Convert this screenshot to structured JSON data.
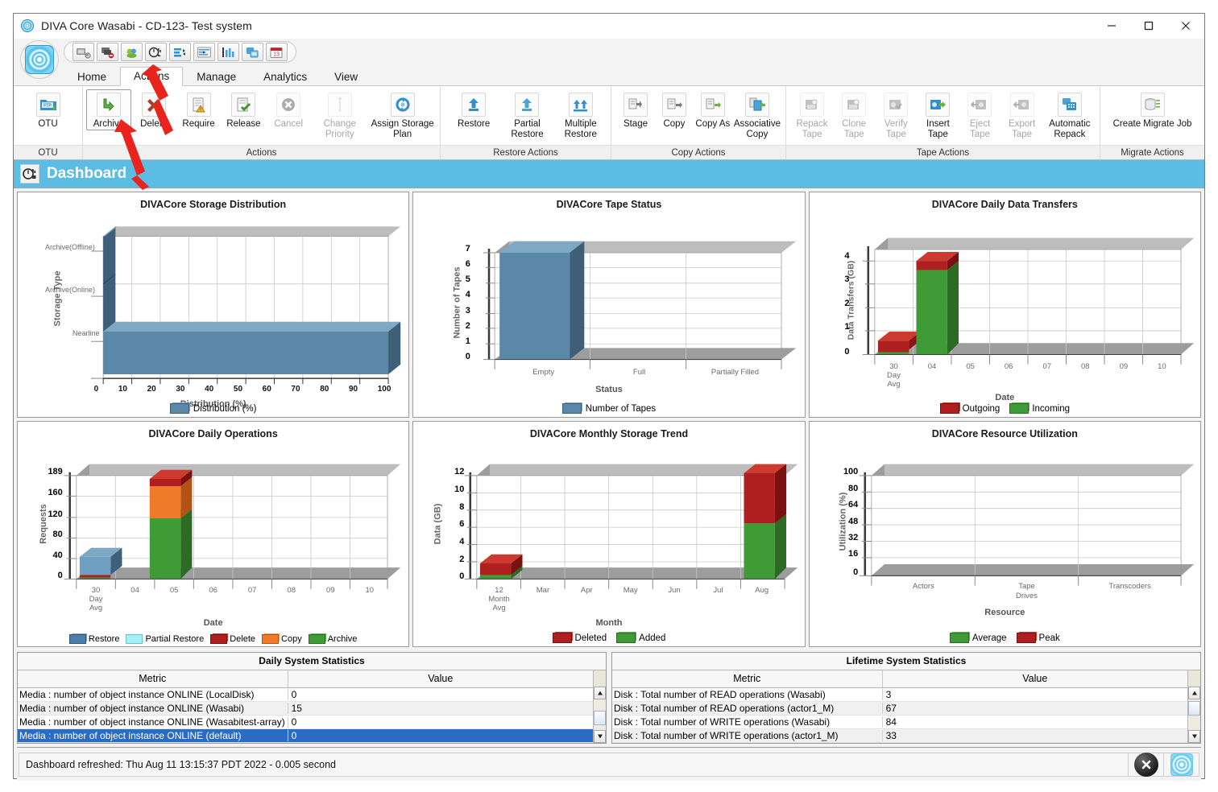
{
  "window": {
    "title": "DIVA Core  Wasabi - CD-123- Test system",
    "minimize_label": "–",
    "maximize_label": "□",
    "close_label": "✕"
  },
  "quick_access": [
    {
      "name": "transfer-icon",
      "tip": "Transfer"
    },
    {
      "name": "cancel-transfer-icon",
      "tip": "Cancel Transfer"
    },
    {
      "name": "archive-objects-icon",
      "tip": "Archive Objects"
    },
    {
      "name": "dashboard-icon",
      "tip": "Dashboard"
    },
    {
      "name": "requests-icon",
      "tip": "Requests"
    },
    {
      "name": "jobs-icon",
      "tip": "Jobs"
    },
    {
      "name": "analytics-icon",
      "tip": "Analytics"
    },
    {
      "name": "copies-icon",
      "tip": "Copies"
    },
    {
      "name": "schedule-icon",
      "tip": "Schedule"
    }
  ],
  "tabs": [
    {
      "label": "Home",
      "active": false
    },
    {
      "label": "Actions",
      "active": true
    },
    {
      "label": "Manage",
      "active": false
    },
    {
      "label": "Analytics",
      "active": false
    },
    {
      "label": "View",
      "active": false
    }
  ],
  "ribbon_groups": [
    {
      "label": "OTU",
      "items": [
        {
          "label": "OTU",
          "icon": "otu-folder-icon",
          "disabled": false,
          "selected": false,
          "width": "normal"
        }
      ]
    },
    {
      "label": "Actions",
      "items": [
        {
          "label": "Archive",
          "icon": "archive-arrow-icon",
          "disabled": false,
          "selected": true,
          "width": "normal"
        },
        {
          "label": "Delete",
          "icon": "delete-x-icon",
          "disabled": false,
          "selected": false,
          "width": "normal"
        },
        {
          "label": "Require",
          "icon": "require-doc-icon",
          "disabled": false,
          "selected": false,
          "width": "normal"
        },
        {
          "label": "Release",
          "icon": "release-doc-icon",
          "disabled": false,
          "selected": false,
          "width": "normal"
        },
        {
          "label": "Cancel",
          "icon": "cancel-circle-icon",
          "disabled": true,
          "selected": false,
          "width": "normal"
        },
        {
          "label": "Change Priority",
          "icon": "change-priority-icon",
          "disabled": true,
          "selected": false,
          "width": "wide"
        },
        {
          "label": "Assign Storage Plan",
          "icon": "assign-storage-plan-icon",
          "disabled": false,
          "selected": false,
          "width": "xwide"
        }
      ]
    },
    {
      "label": "Restore Actions",
      "items": [
        {
          "label": "Restore",
          "icon": "restore-up-arrow-icon",
          "disabled": false,
          "selected": false,
          "width": "normal"
        },
        {
          "label": "Partial Restore",
          "icon": "partial-restore-icon",
          "disabled": false,
          "selected": false,
          "width": "wide"
        },
        {
          "label": "Multiple Restore",
          "icon": "multiple-restore-icon",
          "disabled": false,
          "selected": false,
          "width": "wide"
        }
      ]
    },
    {
      "label": "Copy Actions",
      "items": [
        {
          "label": "Stage",
          "icon": "stage-icon",
          "disabled": false,
          "selected": false,
          "width": "normal"
        },
        {
          "label": "Copy",
          "icon": "copy-icon",
          "disabled": false,
          "selected": false,
          "width": "normal"
        },
        {
          "label": "Copy As",
          "icon": "copy-as-icon",
          "disabled": false,
          "selected": false,
          "width": "normal"
        },
        {
          "label": "Associative Copy",
          "icon": "associative-copy-icon",
          "disabled": false,
          "selected": false,
          "width": "wide"
        }
      ]
    },
    {
      "label": "Tape Actions",
      "items": [
        {
          "label": "Repack Tape",
          "icon": "repack-tape-icon",
          "disabled": true,
          "selected": false,
          "width": "normal"
        },
        {
          "label": "Clone Tape",
          "icon": "clone-tape-icon",
          "disabled": true,
          "selected": false,
          "width": "normal"
        },
        {
          "label": "Verify Tape",
          "icon": "verify-tape-icon",
          "disabled": true,
          "selected": false,
          "width": "normal"
        },
        {
          "label": "Insert Tape",
          "icon": "insert-tape-icon",
          "disabled": false,
          "selected": false,
          "width": "normal"
        },
        {
          "label": "Eject Tape",
          "icon": "eject-tape-icon",
          "disabled": true,
          "selected": false,
          "width": "normal"
        },
        {
          "label": "Export Tape",
          "icon": "export-tape-icon",
          "disabled": true,
          "selected": false,
          "width": "normal"
        },
        {
          "label": "Automatic Repack",
          "icon": "automatic-repack-icon",
          "disabled": false,
          "selected": false,
          "width": "wide"
        }
      ]
    },
    {
      "label": "Migrate Actions",
      "items": [
        {
          "label": "Create Migrate Job",
          "icon": "create-migrate-job-icon",
          "disabled": false,
          "selected": false,
          "width": "xwide"
        }
      ]
    }
  ],
  "page_header": {
    "title": "Dashboard",
    "icon": "dashboard-icon",
    "background": "#5bbce4"
  },
  "colors": {
    "bar_blue": "#5b87a8",
    "bar_blue_top": "#7fa8c4",
    "bar_blue_side": "#3e5f78",
    "green": "#3f9b35",
    "green_top": "#5ab94f",
    "dark_red": "#b01f1f",
    "dark_red_top": "#cf3a30",
    "orange": "#ef7b2a",
    "orange_top": "#f79a53",
    "cyan": "#a8f0f7",
    "floor_gray": "#9d9d9d",
    "wall_gray": "#bdbdbd",
    "selection_blue": "#2a6bc4"
  },
  "chart_data": [
    {
      "type": "bar",
      "orientation": "horizontal",
      "panel": "storage-distribution",
      "title": "DIVACore Storage Distribution",
      "xlabel": "Distribution (%)",
      "ylabel": "Storage Type",
      "categories": [
        "Archive(Offline)",
        "Archive(Online)",
        "Nearline"
      ],
      "values": [
        0,
        0,
        100
      ],
      "xticks": [
        0,
        10,
        20,
        30,
        40,
        50,
        60,
        70,
        80,
        90,
        100
      ],
      "xlim": [
        0,
        100
      ],
      "legend": [
        {
          "label": "Distribution (%)",
          "color": "#5b87a8"
        }
      ],
      "legend_position": "bottom",
      "grid": true
    },
    {
      "type": "bar",
      "orientation": "vertical",
      "panel": "tape-status",
      "title": "DIVACore Tape Status",
      "xlabel": "Status",
      "ylabel": "Number of Tapes",
      "categories": [
        "Empty",
        "Full",
        "Partially Filled"
      ],
      "values": [
        7,
        0,
        0
      ],
      "yticks": [
        0,
        1,
        2,
        3,
        4,
        5,
        6,
        7
      ],
      "ylim": [
        0,
        7
      ],
      "legend": [
        {
          "label": "Number of Tapes",
          "color": "#5b87a8"
        }
      ],
      "legend_position": "bottom",
      "grid": true
    },
    {
      "type": "bar",
      "orientation": "vertical",
      "stacked": true,
      "panel": "daily-data-transfers",
      "title": "DIVACore Daily Data Transfers",
      "xlabel": "Date",
      "ylabel": "Data Transfers (GB)",
      "categories": [
        "30 Day Avg",
        "04",
        "05",
        "06",
        "07",
        "08",
        "09",
        "10"
      ],
      "series": [
        {
          "name": "Incoming",
          "color": "#3f9b35",
          "values": [
            0.1,
            3.7,
            0,
            0,
            0,
            0,
            0,
            0
          ]
        },
        {
          "name": "Outgoing",
          "color": "#b01f1f",
          "values": [
            0.5,
            0.4,
            0,
            0,
            0,
            0,
            0,
            0
          ]
        }
      ],
      "yticks": [
        0,
        1,
        2,
        3,
        4
      ],
      "ylim": [
        0,
        4.5
      ],
      "legend": [
        {
          "label": "Outgoing",
          "color": "#b01f1f"
        },
        {
          "label": "Incoming",
          "color": "#3f9b35"
        }
      ],
      "legend_position": "bottom",
      "grid": true
    },
    {
      "type": "bar",
      "orientation": "vertical",
      "stacked": true,
      "panel": "daily-operations",
      "title": "DIVACore Daily Operations",
      "xlabel": "Date",
      "ylabel": "Requests",
      "categories": [
        "30 Day Avg",
        "04",
        "05",
        "06",
        "07",
        "08",
        "09",
        "10"
      ],
      "series": [
        {
          "name": "Restore",
          "color": "#4a7fa8",
          "values": [
            33,
            0,
            0,
            0,
            0,
            0,
            0,
            0
          ]
        },
        {
          "name": "Partial Restore",
          "color": "#a8f0f7",
          "values": [
            0,
            0,
            0,
            0,
            0,
            0,
            0,
            0
          ]
        },
        {
          "name": "Delete",
          "color": "#b01f1f",
          "values": [
            4,
            14,
            0,
            0,
            0,
            0,
            0,
            0
          ]
        },
        {
          "name": "Copy",
          "color": "#ef7b2a",
          "values": [
            0,
            60,
            0,
            0,
            0,
            0,
            0,
            0
          ]
        },
        {
          "name": "Archive",
          "color": "#3f9b35",
          "values": [
            2,
            115,
            0,
            0,
            0,
            0,
            0,
            0
          ]
        }
      ],
      "yticks": [
        0,
        40,
        80,
        120,
        160,
        189
      ],
      "ylim": [
        0,
        189
      ],
      "legend": [
        {
          "label": "Restore",
          "color": "#4a7fa8"
        },
        {
          "label": "Partial Restore",
          "color": "#a8f0f7"
        },
        {
          "label": "Delete",
          "color": "#b01f1f"
        },
        {
          "label": "Copy",
          "color": "#ef7b2a"
        },
        {
          "label": "Archive",
          "color": "#3f9b35"
        }
      ],
      "legend_position": "bottom",
      "grid": true
    },
    {
      "type": "bar",
      "orientation": "vertical",
      "stacked": true,
      "panel": "monthly-storage-trend",
      "title": "DIVACore Monthly Storage Trend",
      "xlabel": "Month",
      "ylabel": "Data (GB)",
      "categories": [
        "12 Month Avg",
        "Mar",
        "Apr",
        "May",
        "Jun",
        "Jul",
        "Aug"
      ],
      "series": [
        {
          "name": "Added",
          "color": "#3f9b35",
          "values": [
            0.5,
            0,
            0,
            0,
            0,
            0,
            6.5
          ]
        },
        {
          "name": "Deleted",
          "color": "#b01f1f",
          "values": [
            1.4,
            0,
            0,
            0,
            0,
            0,
            5.8
          ]
        }
      ],
      "yticks": [
        0,
        2,
        4,
        6,
        8,
        10,
        12
      ],
      "ylim": [
        0,
        13
      ],
      "legend": [
        {
          "label": "Deleted",
          "color": "#b01f1f"
        },
        {
          "label": "Added",
          "color": "#3f9b35"
        }
      ],
      "legend_position": "bottom",
      "grid": true
    },
    {
      "type": "bar",
      "orientation": "vertical",
      "panel": "resource-utilization",
      "title": "DIVACore Resource Utilization",
      "xlabel": "Resource",
      "ylabel": "Utilization (%)",
      "categories": [
        "Actors",
        "Tape Drives",
        "Transcoders"
      ],
      "series": [
        {
          "name": "Average",
          "color": "#3f9b35",
          "values": [
            0,
            0,
            0
          ]
        },
        {
          "name": "Peak",
          "color": "#b01f1f",
          "values": [
            0,
            0,
            0
          ]
        }
      ],
      "yticks": [
        0,
        16,
        32,
        48,
        64,
        80,
        100
      ],
      "ylim": [
        0,
        100
      ],
      "legend": [
        {
          "label": "Average",
          "color": "#3f9b35"
        },
        {
          "label": "Peak",
          "color": "#b01f1f"
        }
      ],
      "legend_position": "bottom",
      "grid": true
    }
  ],
  "daily_stats": {
    "title": "Daily System Statistics",
    "columns": [
      "Metric",
      "Value"
    ],
    "rows": [
      {
        "metric": "Media : number of object instance  ONLINE (LocalDisk)",
        "value": "0",
        "selected": false
      },
      {
        "metric": "Media : number of object instance  ONLINE (Wasabi)",
        "value": "15",
        "selected": false
      },
      {
        "metric": "Media : number of object instance  ONLINE (Wasabitest-array)",
        "value": "0",
        "selected": false
      },
      {
        "metric": "Media : number of object instance  ONLINE (default)",
        "value": "0",
        "selected": true
      }
    ]
  },
  "lifetime_stats": {
    "title": "Lifetime System Statistics",
    "columns": [
      "Metric",
      "Value"
    ],
    "rows": [
      {
        "metric": "Disk : Total number of READ operations (Wasabi)",
        "value": "3",
        "selected": false
      },
      {
        "metric": "Disk : Total number of READ operations (actor1_M)",
        "value": "67",
        "selected": false
      },
      {
        "metric": "Disk : Total number of WRITE operations (Wasabi)",
        "value": "84",
        "selected": false
      },
      {
        "metric": "Disk : Total number of WRITE operations (actor1_M)",
        "value": "33",
        "selected": false
      }
    ]
  },
  "status_bar": {
    "message": "Dashboard refreshed: Thu Aug 11 13:15:37 PDT 2022 - 0.005 second",
    "close_icon": "close-circle-icon",
    "app_icon": "diva-target-icon"
  },
  "annotations": [
    {
      "name": "arrow-to-actions-tab",
      "target": "Actions tab",
      "color": "#e8241c"
    },
    {
      "name": "arrow-to-archive-button",
      "target": "Archive button",
      "color": "#e8241c"
    }
  ]
}
